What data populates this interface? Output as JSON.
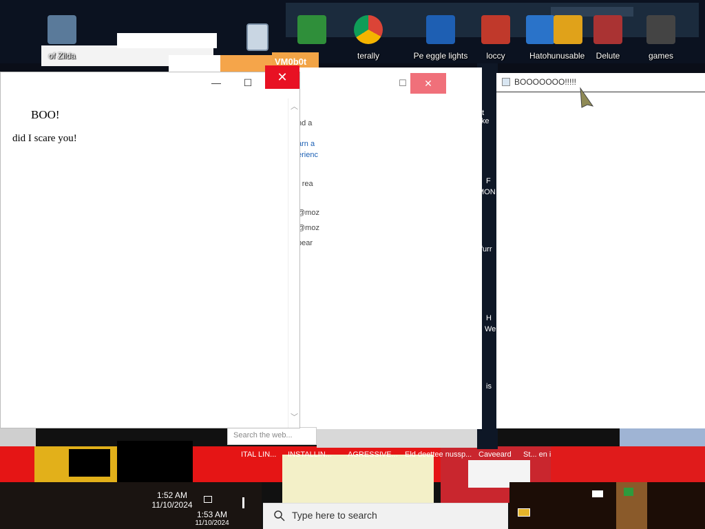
{
  "desktop": {
    "top_icons": [
      {
        "label": "of Zilda",
        "color": "#5a7a9a"
      },
      {
        "label": "",
        "color": "#2f8f3a"
      },
      {
        "label": "terally",
        "color": "#db4437"
      },
      {
        "label": "Pe  eggle lights",
        "color": "#1e5fb3"
      },
      {
        "label": "loccy",
        "color": "#c0392b"
      },
      {
        "label": "Hatoh",
        "color": "#2a73c9"
      },
      {
        "label": "unusable",
        "color": "#e0a21a"
      },
      {
        "label": "Delute",
        "color": "#a33"
      },
      {
        "label": "games",
        "color": "#444"
      }
    ],
    "behind_window_title": "VM0b0t",
    "side_labels": [
      "at like",
      "F",
      "MON",
      "furr",
      "H",
      "We",
      "is"
    ],
    "bottom_labels": [
      "ITAL LIN...",
      "INSTALLIN...",
      "AGRESSIVE...",
      "Eld deettee nussp...",
      "Caveeard",
      "St... en i"
    ]
  },
  "windows": {
    "boo_main": {
      "heading": "BOO!",
      "text": "did I scare you!",
      "minimize": "—",
      "maximize": "☐",
      "close": "✕"
    },
    "middle": {
      "fragments": [
        "nd a",
        "arn a",
        "erienc",
        "- rea",
        "@moz",
        "@moz",
        "bear"
      ],
      "search_placeholder": "Search the web..."
    },
    "boo_right": {
      "title": "BOOOOOOO!!!!!"
    }
  },
  "taskbar": {
    "search_text": "Type here to search",
    "clock_time_1": "1:52 AM",
    "clock_date_1": "11/10/2024",
    "clock_time_2": "1:53 AM",
    "clock_date_2": "11/10/2024"
  }
}
